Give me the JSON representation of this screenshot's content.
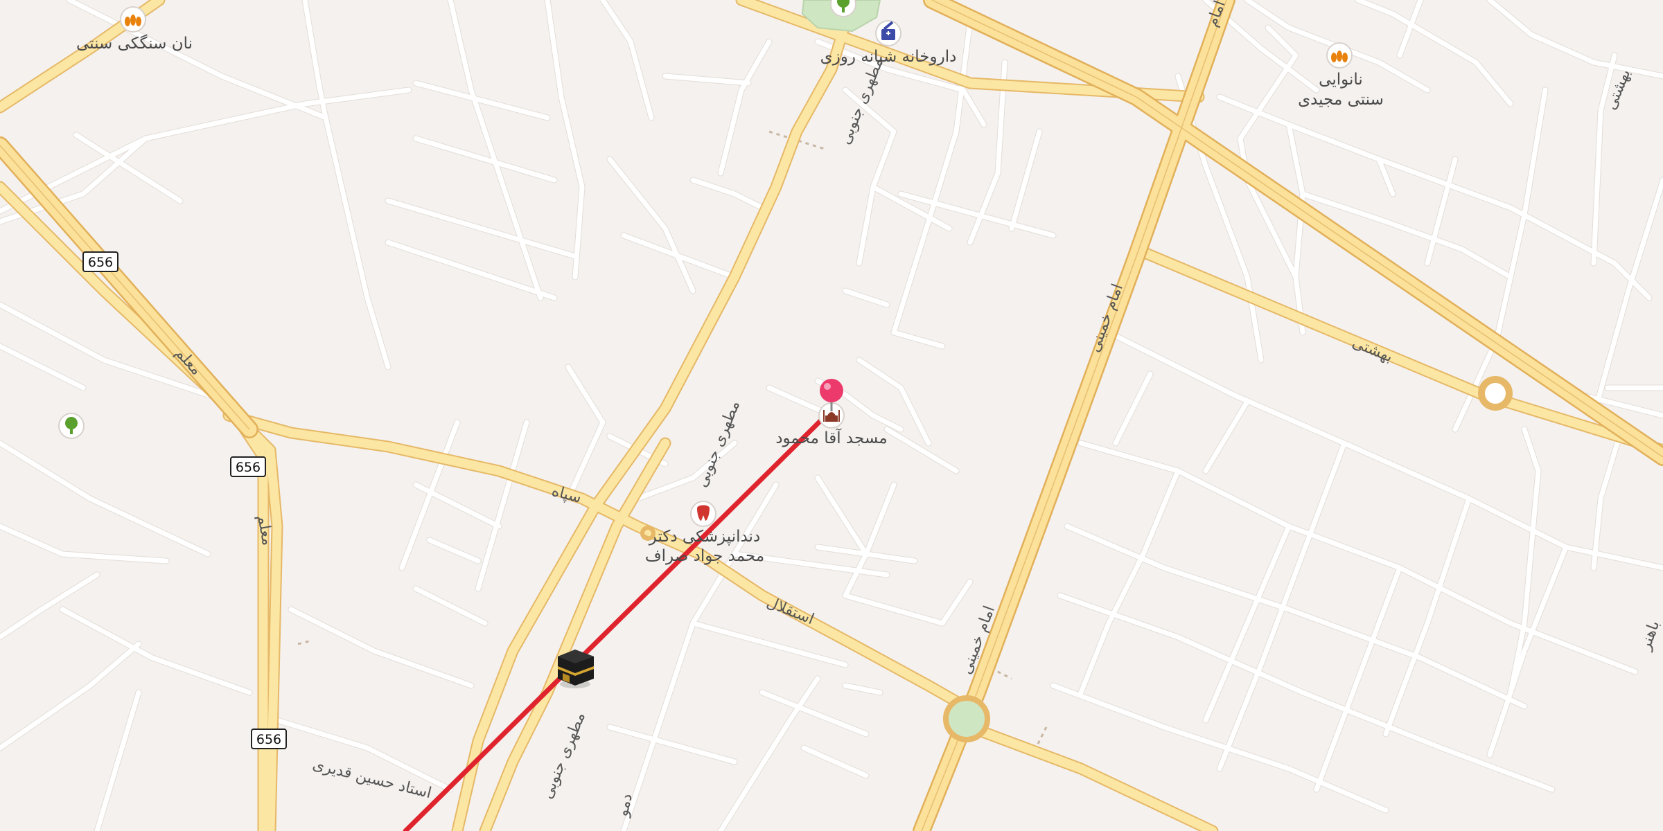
{
  "map": {
    "pois": [
      {
        "id": "bakery_1",
        "label": "نان سنگکی سنتی",
        "icon": "bakery-icon"
      },
      {
        "id": "bakery_2",
        "label_line1": "نانوایی",
        "label_line2": "سنتی مجیدی",
        "icon": "bakery-icon"
      },
      {
        "id": "pharmacy",
        "label": "داروخانه شبانه روزی",
        "icon": "pharmacy-icon"
      },
      {
        "id": "mosque",
        "label": "مسجد آقا محمود",
        "icon": "mosque-icon"
      },
      {
        "id": "dentist",
        "label_line1": "دندانپزشکی دکتر",
        "label_line2": "محمد جواد صراف",
        "icon": "tooth-icon"
      },
      {
        "id": "park_1",
        "icon": "tree-icon"
      },
      {
        "id": "park_2",
        "icon": "tree-icon"
      }
    ],
    "streets": {
      "motahari_top": "مطهری جنوبی",
      "motahari_mid": "مطهری جنوبی",
      "motahari_bottom": "مطهری جنوبی",
      "imam_khomeini_upper": "امام خمینی",
      "imam_khomeini_lower": "امام خمینی",
      "imam_top": "امام",
      "beheshti": "بهشتی",
      "beheshti_right": "بهشتی",
      "sepah": "سپاه",
      "esteghlal": "استقلال",
      "moalem_1": "معلم",
      "moalem_2": "معلم",
      "ostad": "استاد حسین قدیری",
      "side_bottom": "دمو",
      "side_right": "باهنر"
    },
    "route_shields": [
      "656",
      "656",
      "656"
    ],
    "route_line_color": "#e0242e",
    "pin_color": "#ec3a6c",
    "kaaba_marker": "kaaba-icon"
  }
}
